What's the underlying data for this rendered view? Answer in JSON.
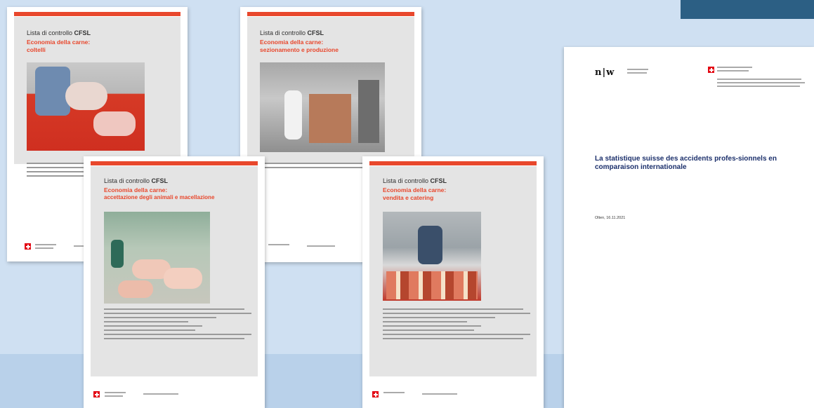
{
  "flyers": [
    {
      "id": "f1",
      "kicker_plain": "Lista di controllo ",
      "kicker_bold": "CFSL",
      "title_line1": "Economia della carne:",
      "title_line2": "coltelli"
    },
    {
      "id": "f2",
      "kicker_plain": "Lista di controllo ",
      "kicker_bold": "CFSL",
      "title_line1": "Economia della carne:",
      "title_line2": "sezionamento e produzione"
    },
    {
      "id": "f3",
      "kicker_plain": "Lista di controllo ",
      "kicker_bold": "CFSL",
      "title_line1": "Economia della carne:",
      "title_line2": "accettazione degli animali e macellazione"
    },
    {
      "id": "f4",
      "kicker_plain": "Lista di controllo ",
      "kicker_bold": "CFSL",
      "title_line1": "Economia della carne:",
      "title_line2": "vendita e catering"
    }
  ],
  "slide": {
    "logo_text": "n|w",
    "title": "La statistique suisse des accidents profes-sionnels en comparaison internationale",
    "date": "Olten, 16.11.2021"
  },
  "colors": {
    "accent": "#e8472c",
    "title_blue": "#1b2f6b",
    "background": "#cfe0f2",
    "dark_block": "#2c5f84"
  }
}
